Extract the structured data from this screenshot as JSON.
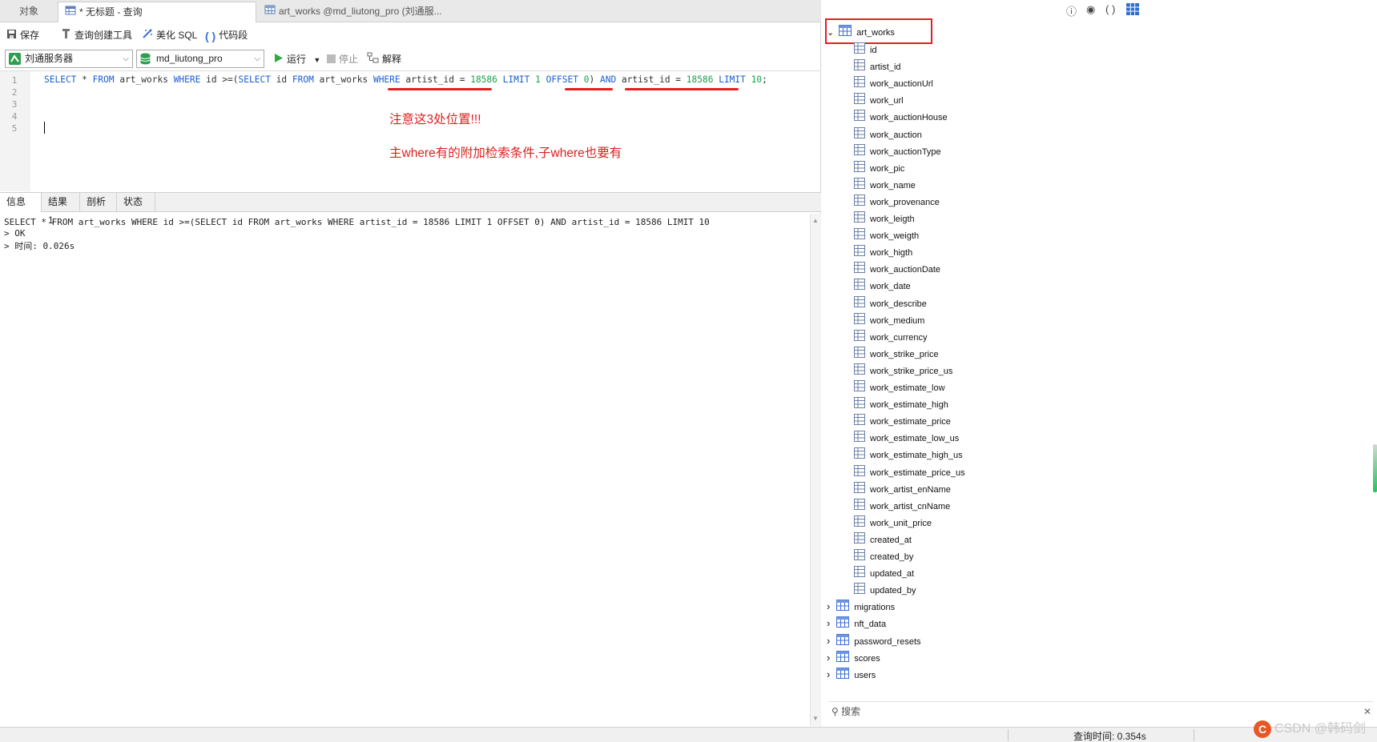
{
  "tabs": [
    {
      "label": "对象"
    },
    {
      "label": "* 无标题 - 查询"
    },
    {
      "label": "art_works @md_liutong_pro (刘通服..."
    }
  ],
  "toolbar": {
    "save": "保存",
    "query_builder": "查询创建工具",
    "beautify": "美化 SQL",
    "snippet": "代码段",
    "run": "运行",
    "stop": "停止",
    "explain": "解释"
  },
  "connection": {
    "server": "刘通服务器",
    "database": "md_liutong_pro"
  },
  "editor": {
    "line_numbers": [
      "1",
      "2",
      "3",
      "4",
      "5"
    ],
    "sql": {
      "p1": "SELECT",
      "p2": " * ",
      "p3": "FROM",
      "p4": " art_works ",
      "p5": "WHERE",
      "p6": " id >=(",
      "p7": "SELECT",
      "p8": " id ",
      "p9": "FROM",
      "p10": " art_works ",
      "p11": "WHERE",
      "p12": " artist_id = ",
      "p13": "18586",
      "p14": " ",
      "p15": "LIMIT",
      "p16": " ",
      "p17": "1",
      "p18": " ",
      "p19": "OFFSET",
      "p20": " ",
      "p21": "0",
      "p22": ") ",
      "p23": "AND",
      "p24": " artist_id = ",
      "p25": "18586",
      "p26": " ",
      "p27": "LIMIT",
      "p28": " ",
      "p29": "10",
      "p30": ";"
    }
  },
  "annotations": {
    "note1": "注意这3处位置!!!",
    "note2": "主where有的附加检索条件,子where也要有"
  },
  "result_tabs": [
    {
      "label": "信息"
    },
    {
      "label": "结果 1"
    },
    {
      "label": "剖析"
    },
    {
      "label": "状态"
    }
  ],
  "output": {
    "line1": "SELECT * FROM art_works WHERE id >=(SELECT id FROM art_works WHERE artist_id = 18586 LIMIT 1 OFFSET 0) AND artist_id = 18586 LIMIT 10",
    "line2": "> OK",
    "line3": "> 时间: 0.026s"
  },
  "tree": {
    "table": "art_works",
    "fields": [
      "id",
      "artist_id",
      "work_auctionUrl",
      "work_url",
      "work_auctionHouse",
      "work_auction",
      "work_auctionType",
      "work_pic",
      "work_name",
      "work_provenance",
      "work_leigth",
      "work_weigth",
      "work_higth",
      "work_auctionDate",
      "work_date",
      "work_describe",
      "work_medium",
      "work_currency",
      "work_strike_price",
      "work_strike_price_us",
      "work_estimate_low",
      "work_estimate_high",
      "work_estimate_price",
      "work_estimate_low_us",
      "work_estimate_high_us",
      "work_estimate_price_us",
      "work_artist_enName",
      "work_artist_cnName",
      "work_unit_price",
      "created_at",
      "created_by",
      "updated_at",
      "updated_by"
    ],
    "other_tables": [
      "migrations",
      "nft_data",
      "password_resets",
      "scores",
      "users"
    ]
  },
  "search_placeholder": "搜索",
  "status": {
    "query_time": "查询时间: 0.354s"
  },
  "watermark": "CSDN @韩码剑",
  "colors": {
    "accent_red": "#e02020",
    "keyword_blue": "#1a5fd0",
    "number_green": "#16a34a"
  }
}
